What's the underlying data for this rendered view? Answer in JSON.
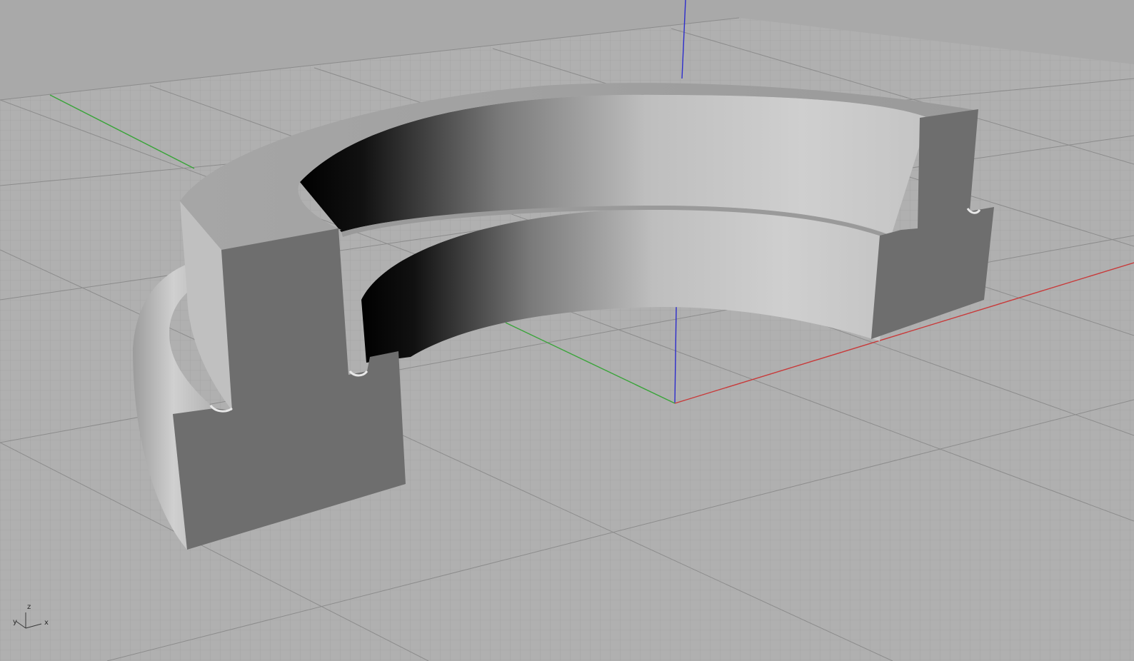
{
  "viewport": {
    "view_type": "perspective",
    "display_mode": "shaded",
    "background_color": "#a9a9a9",
    "grid": true,
    "axis_colors": {
      "x": "#c83a3a",
      "y": "#3aa43a",
      "z": "#2c2ccc"
    }
  },
  "model": {
    "object": "split-ring-section",
    "face_color": "#8e8e8e",
    "section_color": "#6e6e6e"
  },
  "axis_widget": {
    "z": "z",
    "y": "y",
    "x": "x"
  }
}
